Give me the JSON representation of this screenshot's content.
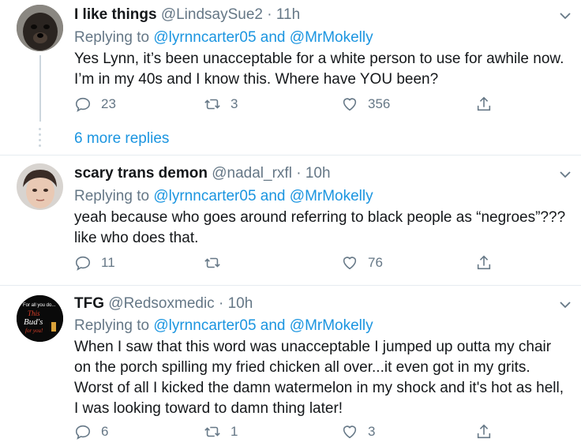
{
  "tweets": [
    {
      "name": "I like things",
      "handle": "@LindsaySue2",
      "time": "11h",
      "replying_prefix": "Replying to",
      "mention1": "@lyrnncarter05",
      "and": "and",
      "mention2": "@MrMokelly",
      "text": "Yes Lynn, it’s been unacceptable for a white person to use for awhile now. I’m in my 40s and I know this. Where have YOU been?",
      "replies": "23",
      "retweets": "3",
      "likes": "356"
    },
    {
      "name": "scary trans demon",
      "handle": "@nadal_rxfl",
      "time": "10h",
      "replying_prefix": "Replying to",
      "mention1": "@lyrnncarter05",
      "and": "and",
      "mention2": "@MrMokelly",
      "text": "yeah because who goes around referring to black people as “negroes”??? like who does that.",
      "replies": "11",
      "retweets": "",
      "likes": "76"
    },
    {
      "name": "TFG",
      "handle": "@Redsoxmedic",
      "time": "10h",
      "replying_prefix": "Replying to",
      "mention1": "@lyrnncarter05",
      "and": "and",
      "mention2": "@MrMokelly",
      "text": "When I saw that this word was unacceptable I jumped up outta my chair on the porch spilling my fried chicken all over...it even got in my grits. Worst of all I kicked the damn watermelon in my shock and it's hot as hell, I was looking toward to damn thing later!",
      "replies": "6",
      "retweets": "1",
      "likes": "3",
      "avatar_text": [
        "For all you do...",
        "This",
        "Bud's",
        "for you!"
      ]
    }
  ],
  "more_replies": "6 more replies",
  "colors": {
    "link": "#1b95e0",
    "muted": "#657786",
    "border": "#e6ecf0"
  }
}
